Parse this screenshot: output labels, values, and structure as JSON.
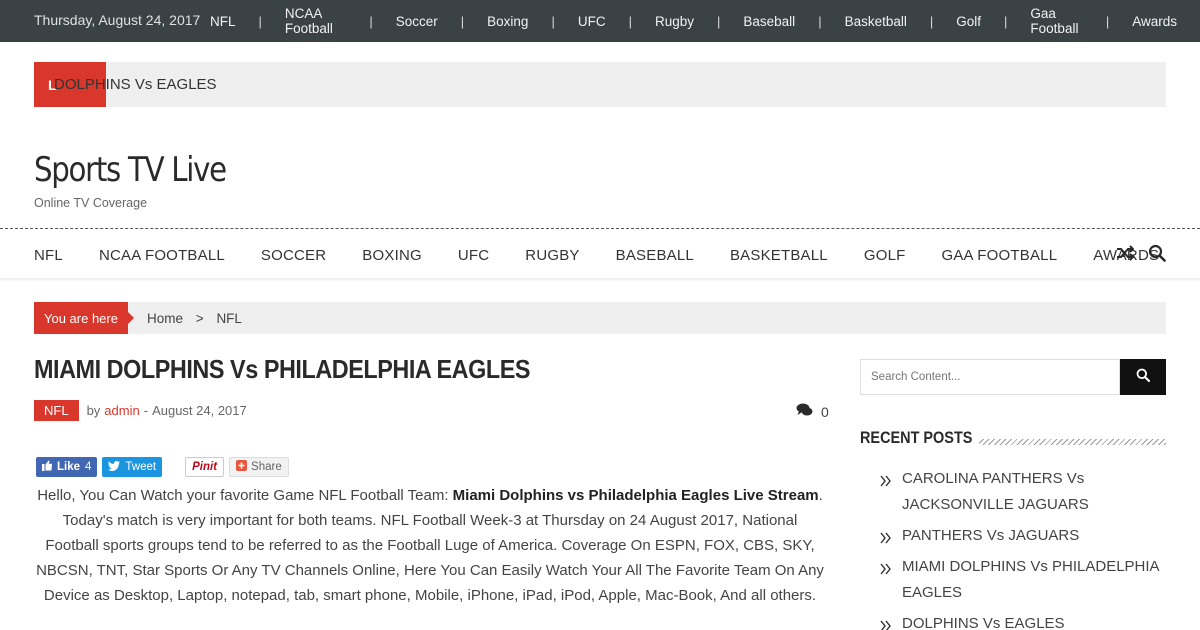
{
  "topbar": {
    "date": "Thursday, August 24, 2017",
    "nav": [
      "NFL",
      "NCAA Football",
      "Soccer",
      "Boxing",
      "UFC",
      "Rugby",
      "Baseball",
      "Basketball",
      "Golf",
      "Gaa Football",
      "Awards"
    ]
  },
  "ticker": {
    "tag": "L",
    "headline": "DOLPHINS Vs EAGLES"
  },
  "site": {
    "title": "Sports TV Live",
    "tagline": "Online TV Coverage"
  },
  "mainnav": [
    "NFL",
    "NCAA FOOTBALL",
    "SOCCER",
    "BOXING",
    "UFC",
    "RUGBY",
    "BASEBALL",
    "BASKETBALL",
    "GOLF",
    "GAA FOOTBALL",
    "AWARDS"
  ],
  "breadcrumb": {
    "label": "You are here",
    "home": "Home",
    "separator": ">",
    "current": "NFL"
  },
  "article": {
    "title": "MIAMI DOLPHINS Vs PHILADELPHIA EAGLES",
    "category": "NFL",
    "by": "by",
    "author": "admin",
    "date_sep": "-",
    "date": "August 24, 2017",
    "comment_count": "0",
    "social": {
      "like": "Like",
      "like_count": "4",
      "tweet": "Tweet",
      "pin": "Pinit",
      "share": "Share"
    },
    "body_lead": "Hello, You Can Watch your favorite Game NFL Football Team: ",
    "body_bold": "Miami Dolphins vs Philadelphia Eagles Live Stream",
    "body_rest": ". Today's match is very important for both teams. NFL Football Week-3 at Thursday on 24 August 2017, National Football sports groups tend to be referred to as the Football Luge of America. Coverage On ESPN, FOX, CBS, SKY, NBCSN, TNT, Star Sports Or Any TV Channels Online, Here You Can Easily Watch Your All The Favorite Team On Any Device as Desktop, Laptop, notepad, tab, smart phone, Mobile, iPhone, iPad, iPod, Apple, Mac-Book, And all others."
  },
  "sidebar": {
    "search_placeholder": "Search Content...",
    "recent_title": "RECENT POSTS",
    "recent_posts": [
      "CAROLINA PANTHERS Vs JACKSONVILLE JAGUARS",
      "PANTHERS Vs JAGUARS",
      "MIAMI DOLPHINS Vs PHILADELPHIA EAGLES",
      "DOLPHINS Vs EAGLES"
    ]
  },
  "colors": {
    "accent": "#d9372b",
    "topbar": "#3a4246"
  },
  "icons": [
    "shuffle-icon",
    "search-icon",
    "comments-icon",
    "chevron-double-right-icon"
  ]
}
